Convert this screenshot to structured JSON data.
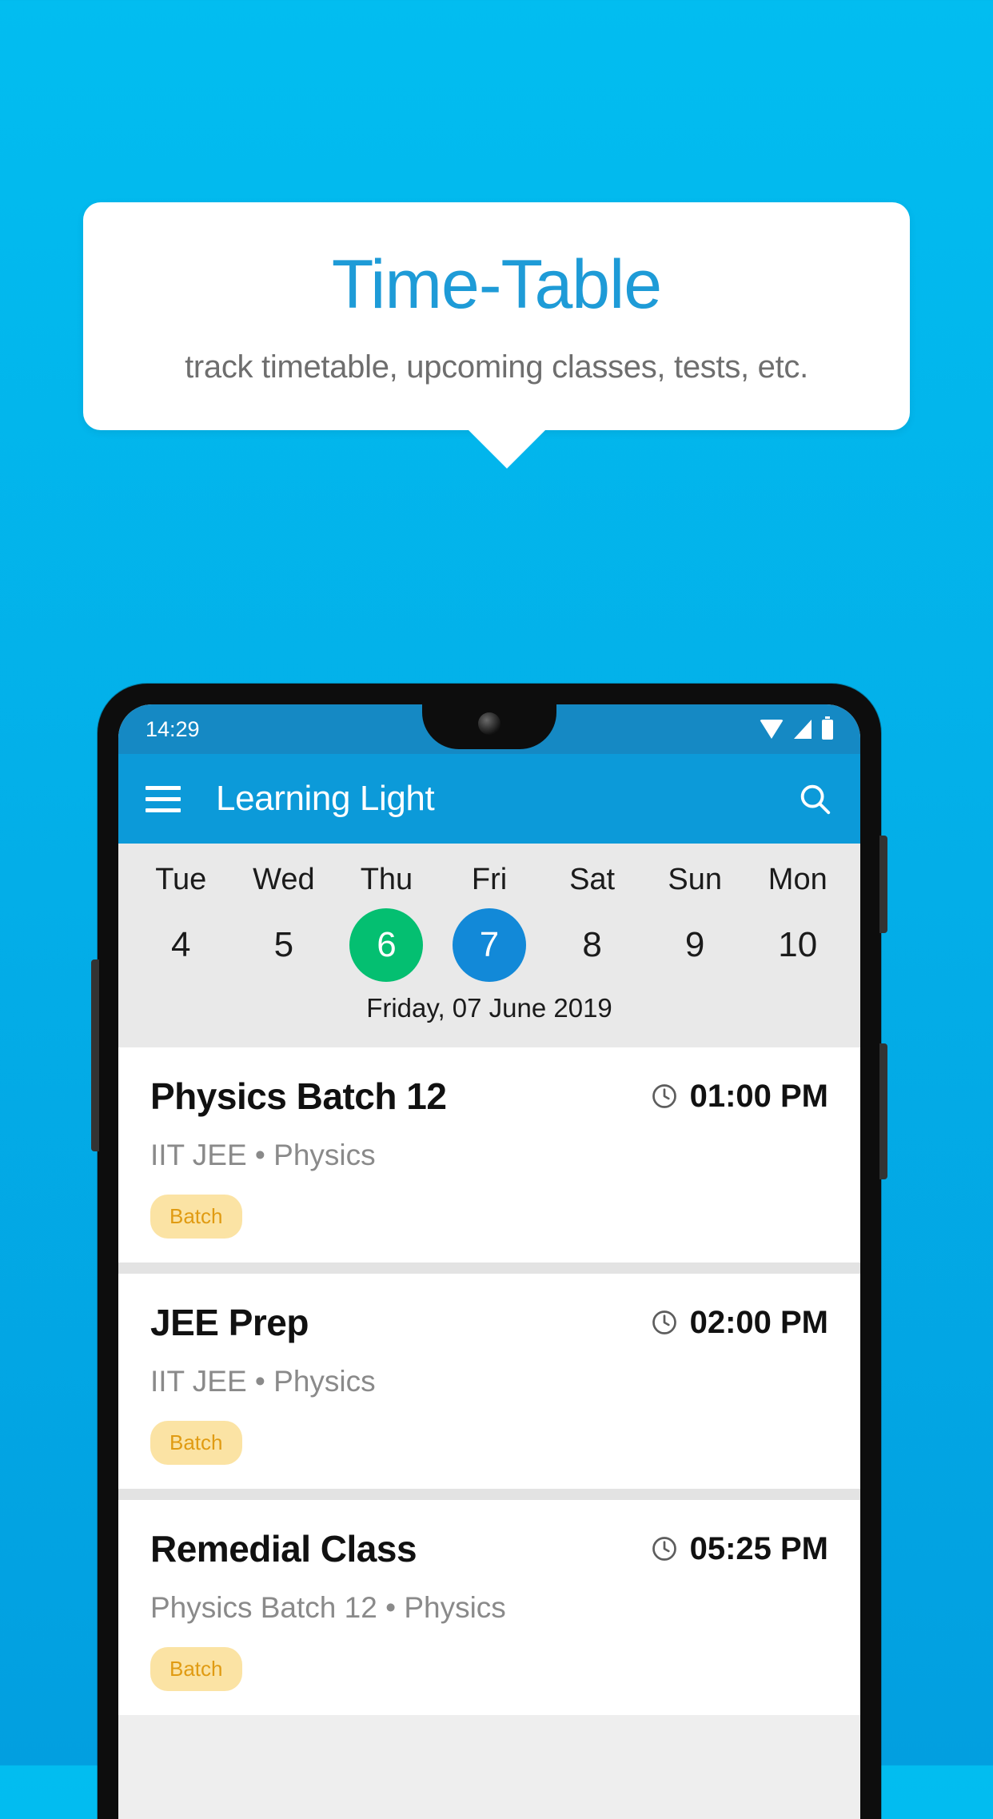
{
  "theme": {
    "bg_top": "#02BDF0",
    "bg_bottom": "#029FE0",
    "accent_blue": "#1E9BD7",
    "appbar_blue": "#0C9AD9",
    "statusbar_blue": "#1589C4",
    "today_green": "#04BF71",
    "selected_blue": "#1289D8",
    "badge_bg": "#FBE3A4",
    "badge_text": "#E09B12"
  },
  "promo": {
    "title": "Time-Table",
    "subtitle": "track timetable, upcoming classes, tests, etc."
  },
  "phone": {
    "statusbar": {
      "time": "14:29",
      "icons": [
        "wifi-icon",
        "signal-icon",
        "battery-icon"
      ]
    },
    "appbar": {
      "menu_icon": "hamburger-menu-icon",
      "title": "Learning Light",
      "search_icon": "search-icon"
    },
    "datestrip": {
      "days": [
        {
          "day": "Tue",
          "num": "4",
          "state": "normal"
        },
        {
          "day": "Wed",
          "num": "5",
          "state": "normal"
        },
        {
          "day": "Thu",
          "num": "6",
          "state": "today"
        },
        {
          "day": "Fri",
          "num": "7",
          "state": "selected"
        },
        {
          "day": "Sat",
          "num": "8",
          "state": "normal"
        },
        {
          "day": "Sun",
          "num": "9",
          "state": "normal"
        },
        {
          "day": "Mon",
          "num": "10",
          "state": "normal"
        }
      ],
      "selected_date_label": "Friday, 07 June 2019"
    },
    "classes": [
      {
        "title": "Physics Batch 12",
        "time": "01:00 PM",
        "time_icon": "clock-icon",
        "subtitle": "IIT JEE • Physics",
        "badge": "Batch"
      },
      {
        "title": "JEE Prep",
        "time": "02:00 PM",
        "time_icon": "clock-icon",
        "subtitle": "IIT JEE • Physics",
        "badge": "Batch"
      },
      {
        "title": "Remedial Class",
        "time": "05:25 PM",
        "time_icon": "clock-icon",
        "subtitle": "Physics Batch 12 • Physics",
        "badge": "Batch"
      }
    ]
  }
}
